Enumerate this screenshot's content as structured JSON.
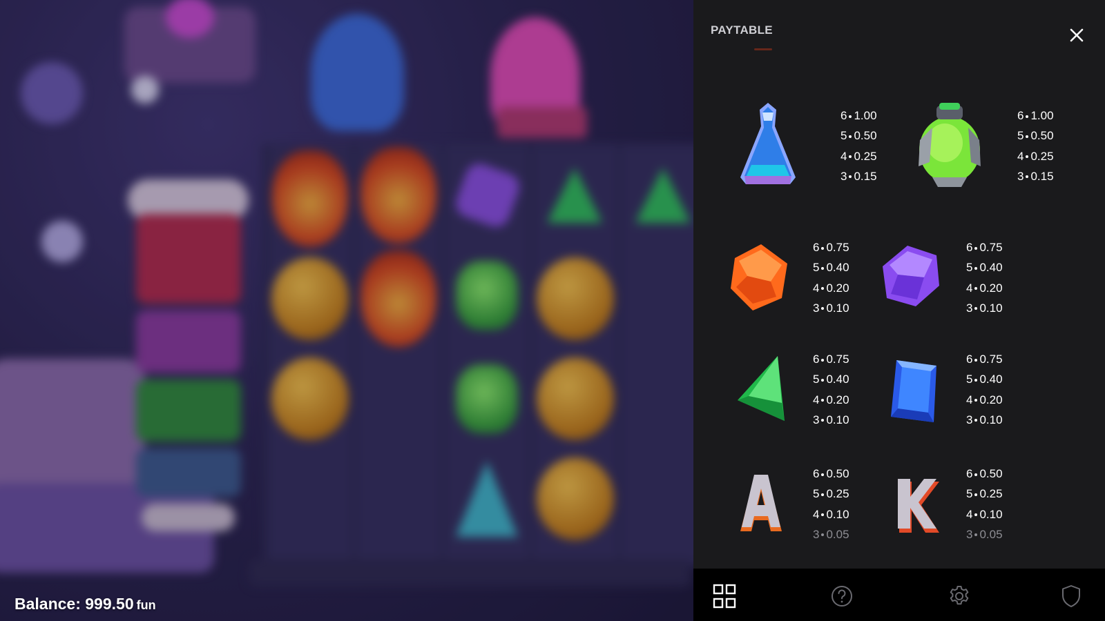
{
  "balance": {
    "label": "Balance:",
    "amount": "999.50",
    "unit": "fun"
  },
  "paytable": {
    "title": "PAYTABLE",
    "close_icon": "close-icon",
    "symbols": [
      {
        "id": "blue-potion",
        "icon": "blue-potion-icon",
        "payouts": [
          {
            "count": "6",
            "value": "1.00"
          },
          {
            "count": "5",
            "value": "0.50"
          },
          {
            "count": "4",
            "value": "0.25"
          },
          {
            "count": "3",
            "value": "0.15"
          }
        ]
      },
      {
        "id": "green-potion",
        "icon": "green-potion-icon",
        "payouts": [
          {
            "count": "6",
            "value": "1.00"
          },
          {
            "count": "5",
            "value": "0.50"
          },
          {
            "count": "4",
            "value": "0.25"
          },
          {
            "count": "3",
            "value": "0.15"
          }
        ]
      },
      {
        "id": "orange-gem",
        "icon": "orange-gem-icon",
        "payouts": [
          {
            "count": "6",
            "value": "0.75"
          },
          {
            "count": "5",
            "value": "0.40"
          },
          {
            "count": "4",
            "value": "0.20"
          },
          {
            "count": "3",
            "value": "0.10"
          }
        ]
      },
      {
        "id": "purple-gem",
        "icon": "purple-gem-icon",
        "payouts": [
          {
            "count": "6",
            "value": "0.75"
          },
          {
            "count": "5",
            "value": "0.40"
          },
          {
            "count": "4",
            "value": "0.20"
          },
          {
            "count": "3",
            "value": "0.10"
          }
        ]
      },
      {
        "id": "green-gem",
        "icon": "green-triangle-gem-icon",
        "payouts": [
          {
            "count": "6",
            "value": "0.75"
          },
          {
            "count": "5",
            "value": "0.40"
          },
          {
            "count": "4",
            "value": "0.20"
          },
          {
            "count": "3",
            "value": "0.10"
          }
        ]
      },
      {
        "id": "blue-gem",
        "icon": "blue-gem-icon",
        "payouts": [
          {
            "count": "6",
            "value": "0.75"
          },
          {
            "count": "5",
            "value": "0.40"
          },
          {
            "count": "4",
            "value": "0.20"
          },
          {
            "count": "3",
            "value": "0.10"
          }
        ]
      },
      {
        "id": "letter-a",
        "icon": "letter-a-icon",
        "payouts": [
          {
            "count": "6",
            "value": "0.50"
          },
          {
            "count": "5",
            "value": "0.25"
          },
          {
            "count": "4",
            "value": "0.10"
          },
          {
            "count": "3",
            "value": "0.05"
          }
        ]
      },
      {
        "id": "letter-k",
        "icon": "letter-k-icon",
        "payouts": [
          {
            "count": "6",
            "value": "0.50"
          },
          {
            "count": "5",
            "value": "0.25"
          },
          {
            "count": "4",
            "value": "0.10"
          },
          {
            "count": "3",
            "value": "0.05"
          }
        ]
      }
    ]
  },
  "bottom_nav": [
    {
      "icon": "grid-icon",
      "active": true
    },
    {
      "icon": "help-icon",
      "active": false
    },
    {
      "icon": "settings-icon",
      "active": false
    },
    {
      "icon": "shield-icon",
      "active": false
    }
  ],
  "colors": {
    "panel_bg": "#1a1a1c",
    "nav_bg": "#000000",
    "text": "#ffffff",
    "muted_text": "#8e8e94"
  }
}
